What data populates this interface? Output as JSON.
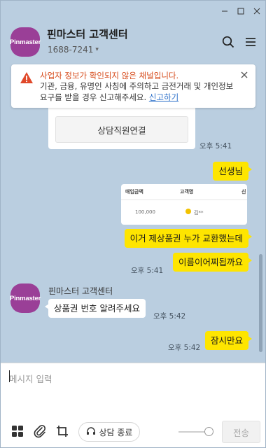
{
  "window": {
    "minimize_icon": "minimize-icon",
    "maximize_icon": "maximize-icon",
    "close_icon": "close-icon"
  },
  "header": {
    "avatar_text": "Pinmaster",
    "name": "핀마스터 고객센터",
    "phone": "1688-7241",
    "phone_toggle": "▾",
    "search_icon": "search-icon",
    "menu_icon": "menu-icon"
  },
  "warning": {
    "title": "사업자 정보가 확인되지 않은 채널입니다.",
    "body": "기관, 금융, 유명인 사칭에 주의하고 금전거래 및 개인정보 요구를 받을 경우 신고해주세요.",
    "link": "신고하기",
    "accent": "#d64a1a"
  },
  "messages": {
    "card_button": "상담직원연결",
    "card_time": "오후 5:41",
    "m1_text": "선생님",
    "image_table": {
      "headers": [
        "매입금액",
        "고객명",
        "신"
      ],
      "row": [
        "100,000",
        "김**",
        ""
      ]
    },
    "m2_text": "이거 제상품권 누가 교환했는데",
    "m3_text": "이름이어찌됩까요",
    "m3_time": "오후 5:41",
    "sender_avatar": "Pinmaster",
    "sender_name": "핀마스터 고객센터",
    "m4_text": "상품권 번호 알려주세요",
    "m4_time": "오후 5:42",
    "m5_text": "잠시만요",
    "m5_time": "오후 5:42"
  },
  "composer": {
    "placeholder": "메시지 입력",
    "end_label": "상담 종료",
    "send_label": "전송"
  },
  "colors": {
    "background": "#bacee0",
    "my_bubble": "#fee500",
    "brand_avatar": "#9a3f97"
  }
}
